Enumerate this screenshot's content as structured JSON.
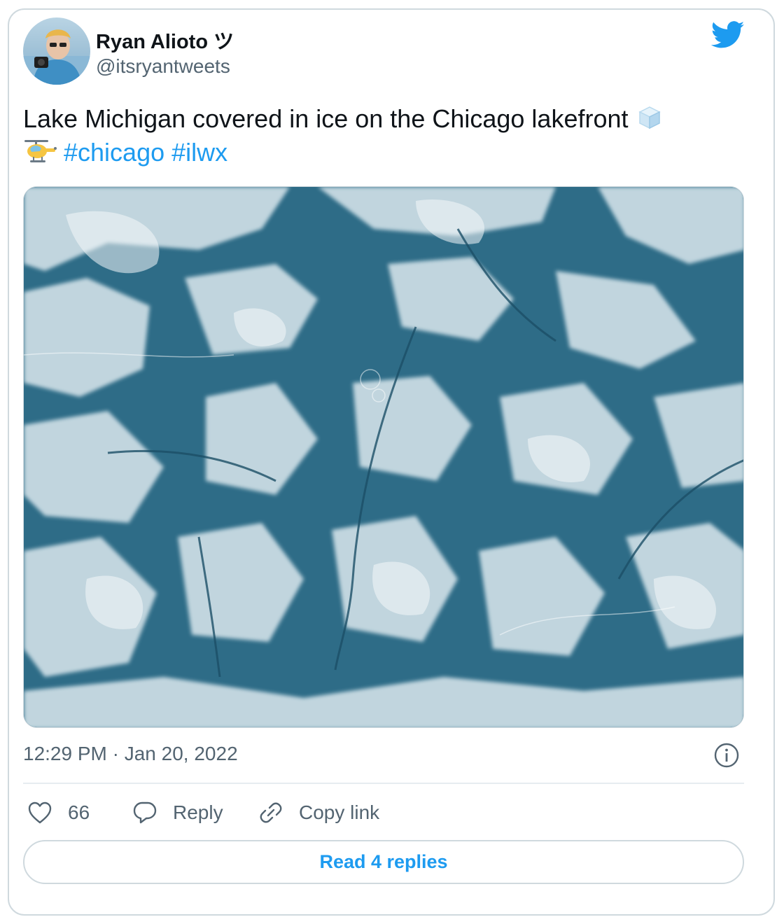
{
  "author": {
    "name": "Ryan Alioto ツ",
    "handle": "@itsryantweets"
  },
  "tweet": {
    "text_main": "Lake Michigan covered in ice on the Chicago lakefront",
    "emoji_ice": "ice-cube-emoji",
    "emoji_helicopter": "helicopter-emoji",
    "hashtags": [
      "#chicago",
      "#ilwx"
    ],
    "timestamp": "12:29 PM · Jan 20, 2022"
  },
  "actions": {
    "like_count": "66",
    "reply_label": "Reply",
    "copy_link_label": "Copy link"
  },
  "read_replies_label": "Read 4 replies",
  "icons": {
    "brand": "twitter-bird-icon",
    "info": "info-icon",
    "like": "heart-icon",
    "reply": "speech-bubble-icon",
    "copy_link": "link-icon"
  },
  "colors": {
    "accent": "#1d9bf0",
    "text_primary": "#0f1419",
    "text_secondary": "#536471",
    "border": "#cfd9de"
  }
}
